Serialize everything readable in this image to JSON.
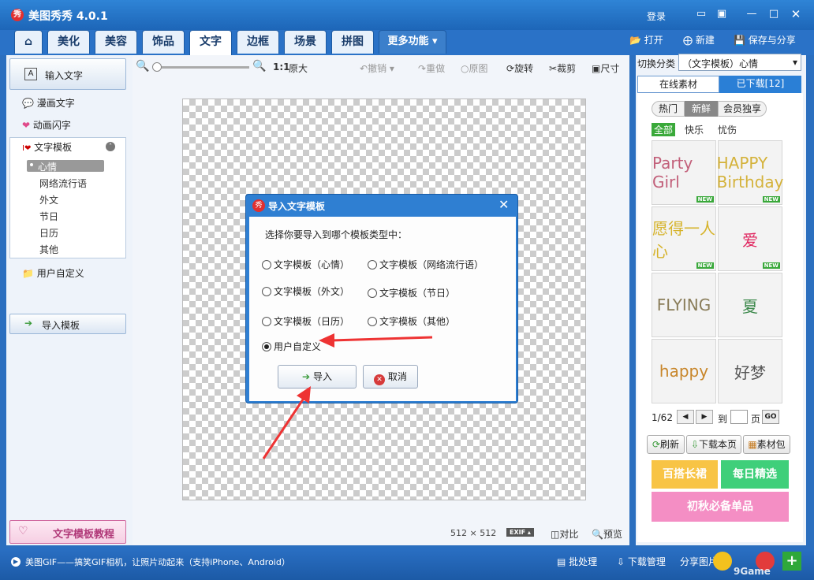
{
  "app": {
    "title": "美图秀秀 4.0.1",
    "logo": "秀",
    "login": "登录"
  },
  "tabs": [
    "美化",
    "美容",
    "饰品",
    "文字",
    "边框",
    "场景",
    "拼图",
    "更多功能"
  ],
  "toolbar_right": {
    "open": "打开",
    "new": "新建",
    "save": "保存与分享"
  },
  "left": {
    "input_text": "输入文字",
    "comic_text": "漫画文字",
    "anim_text": "动画闪字",
    "template": "文字模板",
    "sub_items": [
      "心情",
      "网络流行语",
      "外文",
      "节日",
      "日历",
      "其他"
    ],
    "user_custom": "用户自定义",
    "import_template": "导入模板",
    "tutorial": "文字模板教程"
  },
  "edit_toolbar": {
    "zoom_label": "1:1",
    "original": "原大",
    "undo": "撤销",
    "redo": "重做",
    "orig_image": "原图",
    "rotate": "旋转",
    "crop": "裁剪",
    "size": "尺寸"
  },
  "canvas_info": {
    "width": "512",
    "x": "×",
    "height": "512",
    "exif": "EXIF",
    "compare": "对比",
    "preview": "预览"
  },
  "right": {
    "switch_label": "切换分类",
    "category": "（文字模板）心情",
    "tab_online": "在线素材",
    "tab_downloaded": "已下载[12]",
    "filters": [
      "热门",
      "新鲜",
      "会员独享"
    ],
    "moods": [
      "全部",
      "快乐",
      "忧伤"
    ],
    "thumbs": [
      {
        "text": "Party Girl",
        "new": true,
        "color": "#c2607a"
      },
      {
        "text": "HAPPY Birthday",
        "new": true,
        "color": "#d4b23a"
      },
      {
        "text": "愿得一人心",
        "new": true,
        "color": "#d6b32a"
      },
      {
        "text": "爱",
        "new": true,
        "color": "#e0245e"
      },
      {
        "text": "FLYING",
        "new": false,
        "color": "#8a7d5a"
      },
      {
        "text": "夏",
        "new": false,
        "color": "#3f8a4e"
      },
      {
        "text": "happy",
        "new": false,
        "color": "#c8862a"
      },
      {
        "text": "好梦",
        "new": false,
        "color": "#555555"
      }
    ],
    "page": "1/62",
    "to_label": "到",
    "page_unit": "页",
    "go": "GO",
    "refresh": "刷新",
    "download_page": "下载本页",
    "material_pack": "素材包",
    "promos": [
      "百搭长裙",
      "每日精选",
      "初秋必备单品"
    ]
  },
  "status": {
    "tip": "美图GIF——搞笑GIF相机，让照片动起来（支持iPhone、Android）",
    "batch": "批处理",
    "download_mgr": "下载管理",
    "share": "分享图片",
    "watermark": "9Game"
  },
  "dialog": {
    "title": "导入文字模板",
    "prompt": "选择你要导入到哪个模板类型中：",
    "options": [
      "文字模板（心情）",
      "文字模板（网络流行语）",
      "文字模板（外文）",
      "文字模板（节日）",
      "文字模板（日历）",
      "文字模板（其他）",
      "用户自定义"
    ],
    "selected": "用户自定义",
    "import_btn": "导入",
    "cancel_btn": "取消"
  }
}
